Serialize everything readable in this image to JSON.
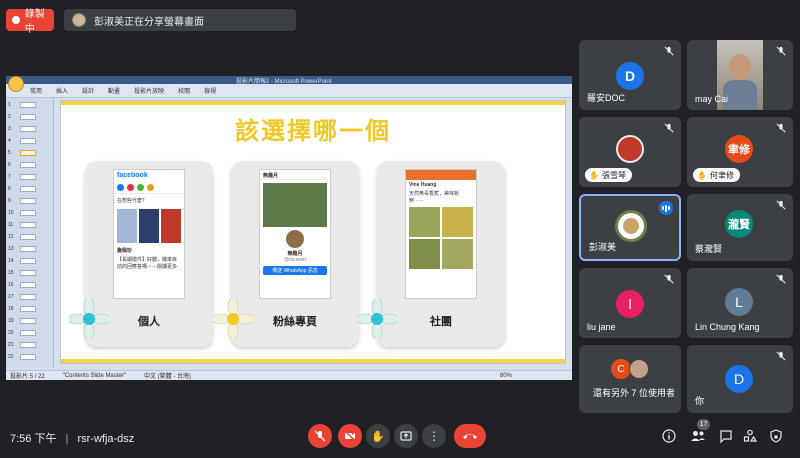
{
  "topbar": {
    "recording_label": "錄製中",
    "presenting_text": "彭淑美正在分享螢幕畫面"
  },
  "shared_screen": {
    "doc_title": "投影片簡報2 - Microsoft PowerPoint",
    "ribbon_tabs": [
      "常用",
      "插入",
      "設計",
      "動畫",
      "投影片放映",
      "校閱",
      "檢視"
    ],
    "slide_numbers": [
      "1",
      "2",
      "3",
      "4",
      "5",
      "6",
      "7",
      "8",
      "9",
      "10",
      "11",
      "12",
      "13",
      "14",
      "15",
      "16",
      "17",
      "18",
      "19",
      "20",
      "21",
      "22"
    ],
    "active_slide": 5,
    "slide_title": "該選擇哪一個",
    "cards": [
      {
        "label": "個人",
        "app": "facebook",
        "post_text": "在想些什麼？",
        "post_body": "【長期徵件】好體，機率目前的回應答嗎⋯⋯閱讀更多",
        "poster": "詹佩珍"
      },
      {
        "label": "粉絲專頁",
        "page_name": "無趣月",
        "sub": "@nicewin",
        "button": "傳送 WhatsApp 訊息"
      },
      {
        "label": "社團",
        "group_name": "Vine Huang",
        "post_text": "天然無毒香蕉，美味新鮮⋯⋯"
      }
    ],
    "status": {
      "slide": "投影片 5 / 22",
      "theme": "\"Contents Slide Master\"",
      "lang": "中文 (繁體 - 台灣)",
      "zoom": "80%"
    }
  },
  "participants": [
    {
      "name": "羅安DOC",
      "initials": "D",
      "color": "#1a73e8",
      "muted": true
    },
    {
      "name": "may Cai",
      "initials": "",
      "color": "#7a8a7d",
      "muted": true,
      "video": true
    },
    {
      "name": "張雪琴",
      "initials": "",
      "color": "#c0392b",
      "muted": true,
      "hand": true
    },
    {
      "name": "何聿修",
      "initials": "聿修",
      "color": "#e64a19",
      "muted": true,
      "hand": true
    },
    {
      "name": "彭淑美",
      "initials": "",
      "color": "#ffffff",
      "speaking": true
    },
    {
      "name": "蔡瀧賢",
      "initials": "瀧賢",
      "color": "#00897b",
      "muted": true
    },
    {
      "name": "liu jane",
      "initials": "l",
      "color": "#e91e63",
      "muted": true
    },
    {
      "name": "Lin Chung Kang",
      "initials": "L",
      "color": "#5f7d95",
      "muted": true
    },
    {
      "name": "還有另外 7 位使用者",
      "initials": "C",
      "color": "#e64a19"
    },
    {
      "name": "你",
      "initials": "D",
      "color": "#1a73e8",
      "muted": true
    }
  ],
  "bottombar": {
    "time": "7:56 下午",
    "meeting_code": "rsr-wfja-dsz",
    "participant_count": "17"
  },
  "colors": {
    "background": "#202124",
    "tile": "#3c4043",
    "red": "#ea4335",
    "accent_blue": "#8ab4f8",
    "slide_yellow": "#f0c929"
  }
}
